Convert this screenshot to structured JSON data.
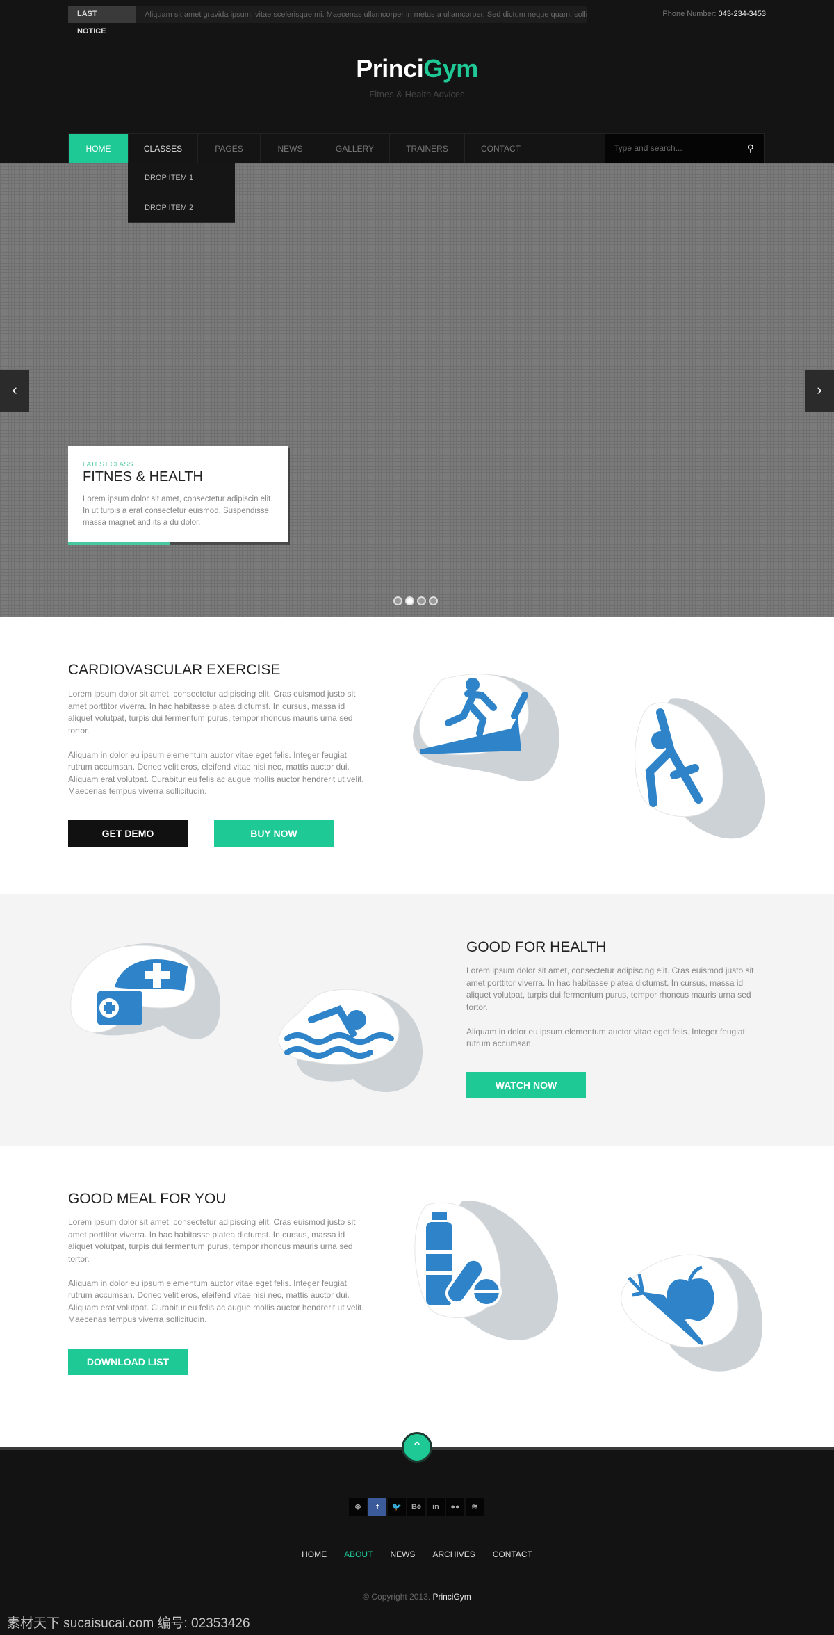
{
  "topbar": {
    "notice_label": "LAST NOTICE",
    "notice_text": "Aliquam sit amet gravida ipsum, vitae scelerisque mi. Maecenas ullamcorper in metus a ullamcorper. Sed dictum neque quam, sollicit",
    "phone_label": "Phone Number:",
    "phone": "043-234-3453"
  },
  "brand": {
    "name_part1": "Princi",
    "name_part2": "Gym",
    "tagline": "Fitnes & Health Advices",
    "accent": "#1ec995"
  },
  "nav": {
    "items": [
      "HOME",
      "CLASSES",
      "PAGES",
      "NEWS",
      "GALLERY",
      "TRAINERS",
      "CONTACT"
    ],
    "active": "HOME",
    "dropdown": [
      "DROP ITEM 1",
      "DROP ITEM 2"
    ],
    "search_placeholder": "Type and search..."
  },
  "hero": {
    "kicker": "LATEST CLASS",
    "title": "FITNES & HEALTH",
    "text": "Lorem ipsum dolor sit amet, consectetur adipiscin elit. In ut turpis a erat consectetur euismod. Suspendisse massa magnet and its a du dolor.",
    "progress_percent": 46,
    "slides": 4,
    "active_slide": 2,
    "prev_icon": "chevron-left",
    "next_icon": "chevron-right"
  },
  "sections": [
    {
      "title": "CARDIOVASCULAR EXERCISE",
      "p1": "Lorem ipsum dolor sit amet, consectetur adipiscing elit. Cras euismod justo sit amet porttitor viverra. In hac habitasse platea dictumst. In cursus, massa id aliquet volutpat, turpis dui fermentum purus, tempor rhoncus mauris urna sed tortor.",
      "p2": " Aliquam in dolor eu ipsum elementum auctor vitae eget felis. Integer feugiat rutrum accumsan. Donec velit eros, eleifend vitae nisi nec, mattis auctor dui. Aliquam erat volutpat. Curabitur eu felis ac augue mollis auctor hendrerit ut velit. Maecenas tempus viverra sollicitudin.",
      "buttons": [
        "GET DEMO",
        "BUY NOW"
      ],
      "icons": [
        "treadmill-icon",
        "stretching-person-icon"
      ]
    },
    {
      "title": "GOOD FOR HEALTH",
      "p1": "Lorem ipsum dolor sit amet, consectetur adipiscing elit. Cras euismod justo sit amet porttitor viverra. In hac habitasse platea dictumst. In cursus, massa id aliquet volutpat, turpis dui fermentum purus, tempor rhoncus mauris urna sed tortor.",
      "p2": " Aliquam in dolor eu ipsum elementum auctor vitae eget felis. Integer feugiat rutrum accumsan.",
      "buttons": [
        "WATCH NOW"
      ],
      "icons": [
        "medical-kit-icon",
        "swimmer-icon"
      ]
    },
    {
      "title": "GOOD MEAL FOR YOU",
      "p1": "Lorem ipsum dolor sit amet, consectetur adipiscing elit. Cras euismod justo sit amet porttitor viverra. In hac habitasse platea dictumst. In cursus, massa id aliquet volutpat, turpis dui fermentum purus, tempor rhoncus mauris urna sed tortor.",
      "p2": " Aliquam in dolor eu ipsum elementum auctor vitae eget felis. Integer feugiat rutrum accumsan. Donec velit eros, eleifend vitae nisi nec, mattis auctor dui. Aliquam erat volutpat. Curabitur eu felis ac augue mollis auctor hendrerit ut velit. Maecenas tempus viverra sollicitudin.",
      "buttons": [
        "DOWNLOAD LIST"
      ],
      "icons": [
        "water-bottle-pills-icon",
        "carrot-apple-icon"
      ]
    }
  ],
  "footer": {
    "social": [
      {
        "icon": "dribbble-icon",
        "glyph": "⊛"
      },
      {
        "icon": "facebook-icon",
        "glyph": "f"
      },
      {
        "icon": "twitter-icon",
        "glyph": "🐦"
      },
      {
        "icon": "behance-icon",
        "glyph": "Bē"
      },
      {
        "icon": "linkedin-icon",
        "glyph": "in"
      },
      {
        "icon": "flickr-icon",
        "glyph": "●●"
      },
      {
        "icon": "rss-icon",
        "glyph": "≋"
      }
    ],
    "links": [
      "HOME",
      "ABOUT",
      "NEWS",
      "ARCHIVES",
      "CONTACT"
    ],
    "active_link": "ABOUT",
    "copyright": "© Copyright 2013.",
    "copyright_brand": "PrinciGym"
  },
  "watermark": "素材天下 sucaisucai.com  编号: 02353426"
}
